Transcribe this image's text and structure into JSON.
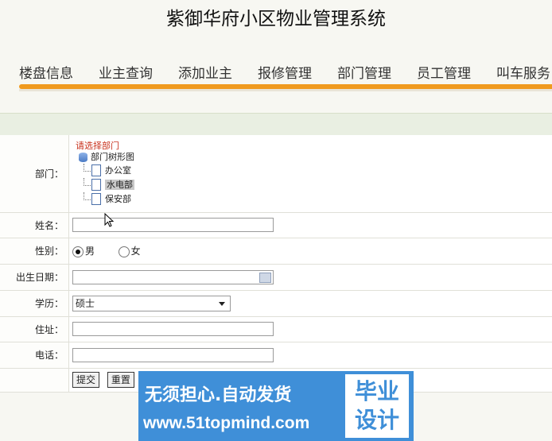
{
  "header": {
    "title": "紫御华府小区物业管理系统"
  },
  "nav": {
    "items": [
      "楼盘信息",
      "业主查询",
      "添加业主",
      "报修管理",
      "部门管理",
      "员工管理",
      "叫车服务"
    ]
  },
  "form": {
    "department": {
      "label": "部门：",
      "prompt": "请选择部门",
      "root": "部门树形图",
      "nodes": [
        "办公室",
        "水电部",
        "保安部"
      ],
      "selected": "水电部"
    },
    "name": {
      "label": "姓名：",
      "value": ""
    },
    "gender": {
      "label": "性别：",
      "options": [
        "男",
        "女"
      ],
      "selected": "男"
    },
    "birthdate": {
      "label": "出生日期：",
      "value": ""
    },
    "education": {
      "label": "学历：",
      "value": "硕士"
    },
    "address": {
      "label": "住址：",
      "value": ""
    },
    "phone": {
      "label": "电话：",
      "value": ""
    },
    "buttons": {
      "submit": "提交",
      "reset": "重置"
    }
  },
  "watermark": {
    "line1": "无须担心.自动发货",
    "line2": "www.51topmind.com",
    "box_line1": "毕业",
    "box_line2": "设计"
  },
  "colors": {
    "accent": "#f09a1e",
    "header_row": "#e9efe2",
    "watermark": "#3f8fd8"
  }
}
